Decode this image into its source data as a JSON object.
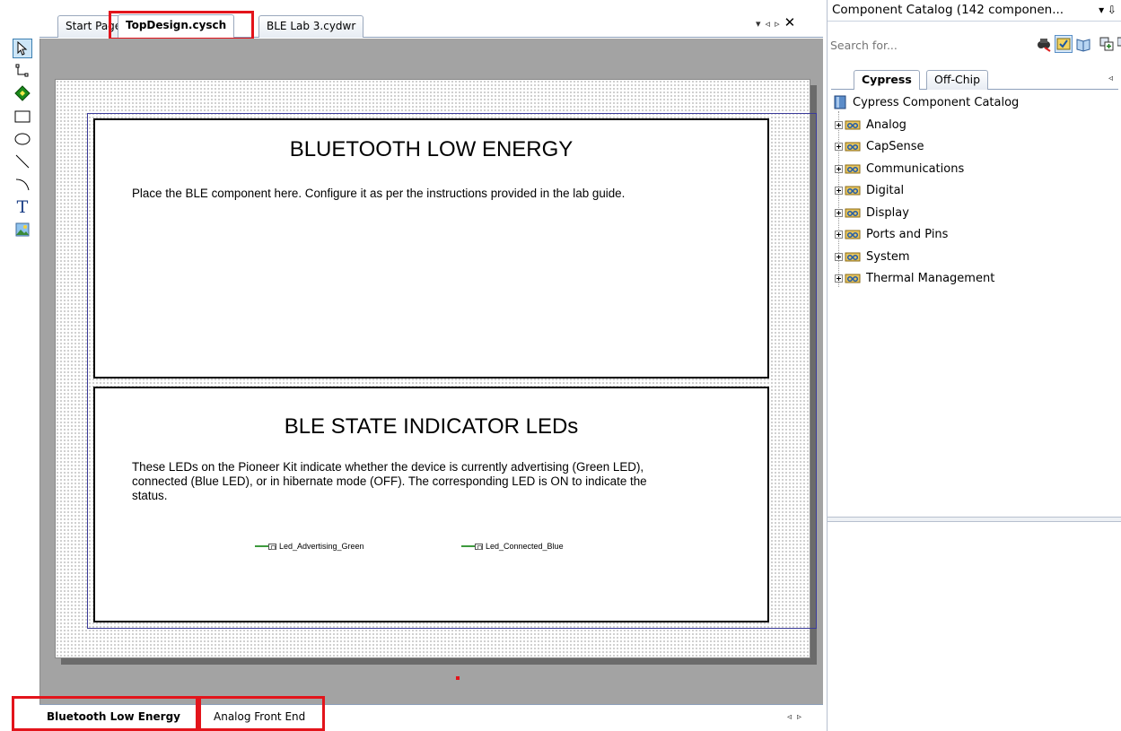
{
  "document_tabs": [
    {
      "label": "Start Page",
      "active": false
    },
    {
      "label": "TopDesign.cysch",
      "active": true
    },
    {
      "label": "BLE Lab 3.cydwr",
      "active": false
    }
  ],
  "document_tab_controls": {
    "dropdown": "▾",
    "prev": "◃",
    "next": "▹",
    "close": "✕"
  },
  "toolbar": {
    "tools": [
      {
        "name": "select-tool",
        "icon": "pointer-icon",
        "selected": true
      },
      {
        "name": "wire-tool",
        "icon": "wire-icon"
      },
      {
        "name": "component-tool",
        "icon": "diamond-icon"
      },
      {
        "name": "rectangle-tool",
        "icon": "rectangle-icon"
      },
      {
        "name": "ellipse-tool",
        "icon": "ellipse-icon"
      },
      {
        "name": "line-tool",
        "icon": "line-icon"
      },
      {
        "name": "arc-tool",
        "icon": "arc-icon"
      },
      {
        "name": "text-tool",
        "icon": "text-icon",
        "glyph": "T"
      },
      {
        "name": "image-tool",
        "icon": "image-icon"
      }
    ]
  },
  "schematic": {
    "ble_section": {
      "title": "BLUETOOTH LOW ENERGY",
      "text": "Place the BLE component here. Configure it as per the instructions provided in the lab guide."
    },
    "led_section": {
      "title": "BLE STATE INDICATOR LEDs",
      "text_lines": [
        "These LEDs on the Pioneer Kit indicate whether the device is currently advertising (Green LED),",
        "connected (Blue LED), or in hibernate mode (OFF). The corresponding LED is ON to indicate the",
        "status."
      ],
      "pins": [
        "Led_Advertising_Green",
        "Led_Connected_Blue"
      ]
    }
  },
  "page_tabs": [
    {
      "label": "Bluetooth Low Energy",
      "active": true
    },
    {
      "label": "Analog Front End",
      "active": false
    }
  ],
  "page_tab_controls": {
    "prev": "◃",
    "next": "▹"
  },
  "catalog": {
    "title": "Component Catalog (142 componen...",
    "title_controls": "▾ ⇩",
    "search_placeholder": "Search for...",
    "tabs": [
      {
        "label": "Cypress",
        "active": true
      },
      {
        "label": "Off-Chip",
        "active": false
      }
    ],
    "tab_arrow": "◃",
    "root_label": "Cypress Component Catalog",
    "items": [
      "Analog",
      "CapSense",
      "Communications",
      "Digital",
      "Display",
      "Ports and Pins",
      "System",
      "Thermal Management"
    ]
  },
  "colors": {
    "highlight": "#e3141b",
    "canvas_background": "#a3a3a3",
    "wire_green": "#3d9a3d",
    "frame_blue": "#3b3b9a"
  }
}
